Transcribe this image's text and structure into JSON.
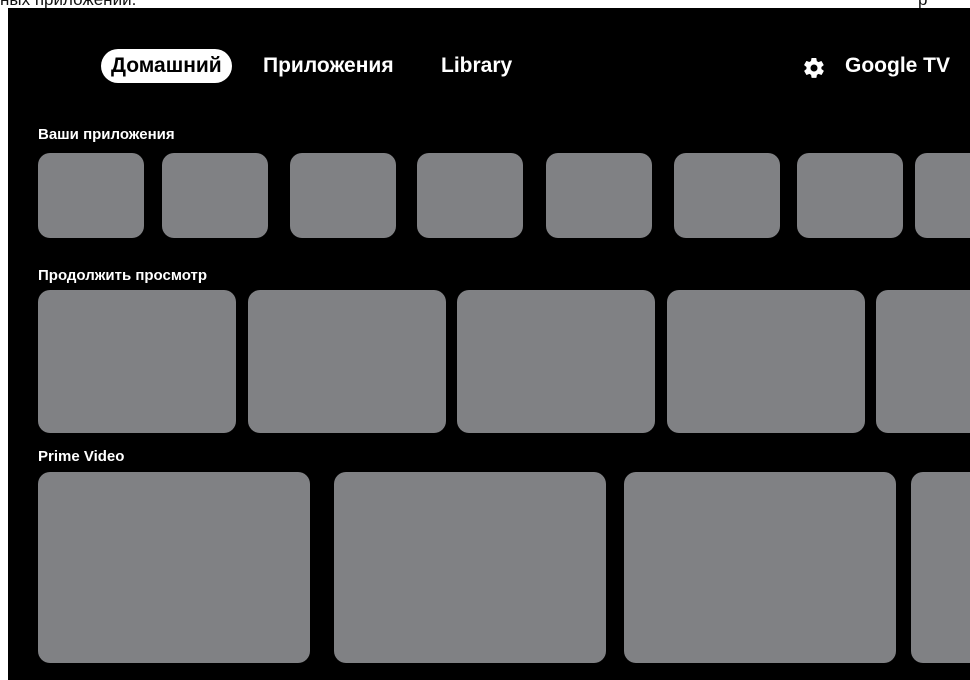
{
  "top_clipped": {
    "left_text": "ных приложений.",
    "right_text": "р"
  },
  "nav": {
    "tabs": [
      {
        "label": "Домашний",
        "active": true
      },
      {
        "label": "Приложения",
        "active": false
      },
      {
        "label": "Library",
        "active": false
      }
    ],
    "settings_icon": "gear-icon",
    "brand": "Google TV"
  },
  "rows": [
    {
      "title": "Ваши приложения",
      "tile_count": 8
    },
    {
      "title": "Продолжить просмотр",
      "tile_count": 5
    },
    {
      "title": "Prime Video",
      "tile_count": 4
    }
  ],
  "colors": {
    "background": "#000000",
    "tile": "#808184",
    "text": "#ffffff",
    "active_tab_bg": "#ffffff"
  }
}
